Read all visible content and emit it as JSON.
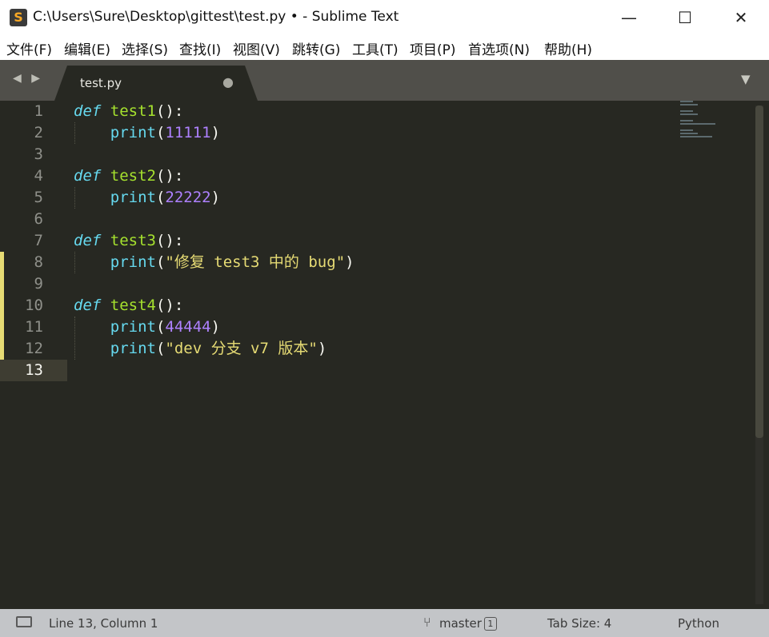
{
  "window": {
    "title": "C:\\Users\\Sure\\Desktop\\gittest\\test.py • - Sublime Text",
    "app_icon": "S",
    "minimize_glyph": "—",
    "maximize_glyph": "☐",
    "close_glyph": "✕"
  },
  "menu": {
    "items": [
      "文件(F)",
      "编辑(E)",
      "选择(S)",
      "查找(I)",
      "视图(V)",
      "跳转(G)",
      "工具(T)",
      "项目(P)",
      "首选项(N)",
      "帮助(H)"
    ]
  },
  "tabs": {
    "nav_arrows": "◀ ▶",
    "active_label": "test.py",
    "dirty_marker": "●",
    "menu_glyph": "▼"
  },
  "editor": {
    "line_numbers": [
      "1",
      "2",
      "3",
      "4",
      "5",
      "6",
      "7",
      "8",
      "9",
      "10",
      "11",
      "12",
      "13"
    ],
    "current_line": "13",
    "code": {
      "l1": {
        "def": "def",
        "name": "test1",
        "rest": "():"
      },
      "l2": {
        "indent": "    ",
        "fn": "print",
        "open": "(",
        "arg": "11111",
        "close": ")"
      },
      "l4": {
        "def": "def",
        "name": "test2",
        "rest": "():"
      },
      "l5": {
        "indent": "    ",
        "fn": "print",
        "open": "(",
        "arg": "22222",
        "close": ")"
      },
      "l7": {
        "def": "def",
        "name": "test3",
        "rest": "():"
      },
      "l8": {
        "indent": "    ",
        "fn": "print",
        "open": "(",
        "arg": "\"修复 test3 中的 bug\"",
        "close": ")"
      },
      "l10": {
        "def": "def",
        "name": "test4",
        "rest": "():"
      },
      "l11": {
        "indent": "    ",
        "fn": "print",
        "open": "(",
        "arg": "44444",
        "close": ")"
      },
      "l12": {
        "indent": "    ",
        "fn": "print",
        "open": "(",
        "arg": "\"dev 分支 v7 版本\"",
        "close": ")"
      }
    }
  },
  "status": {
    "position": "Line 13, Column 1",
    "branch": "master",
    "branch_count": "1",
    "tab_size": "Tab Size: 4",
    "syntax": "Python"
  },
  "colors": {
    "background": "#272822",
    "keyword": "#66d9ef",
    "function_name": "#a6e22e",
    "number": "#ae81ff",
    "string": "#e6db74",
    "modified_marker": "#e6db74"
  }
}
